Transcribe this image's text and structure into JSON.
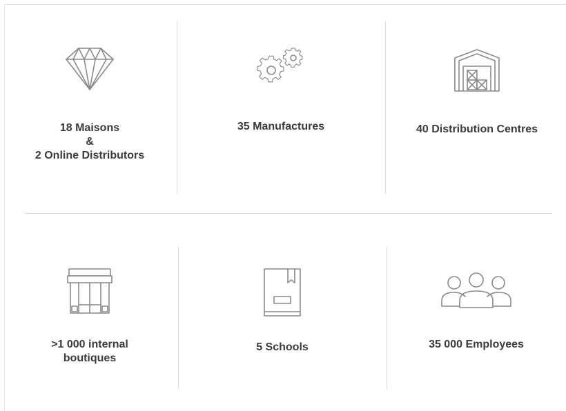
{
  "stats": [
    {
      "icon": "diamond-icon",
      "label": "18 Maisons\n&\n2 Online Distributors"
    },
    {
      "icon": "gears-icon",
      "label": "35 Manufactures"
    },
    {
      "icon": "warehouse-icon",
      "label": "40 Distribution Centres"
    },
    {
      "icon": "boutique-icon",
      "label": ">1 000 internal\nboutiques"
    },
    {
      "icon": "book-icon",
      "label": "5 Schools"
    },
    {
      "icon": "people-icon",
      "label": "35 000 Employees"
    }
  ],
  "colors": {
    "icon_stroke": "#8a8a8a",
    "text": "#3b3b3b",
    "divider": "#dcdcdc"
  }
}
